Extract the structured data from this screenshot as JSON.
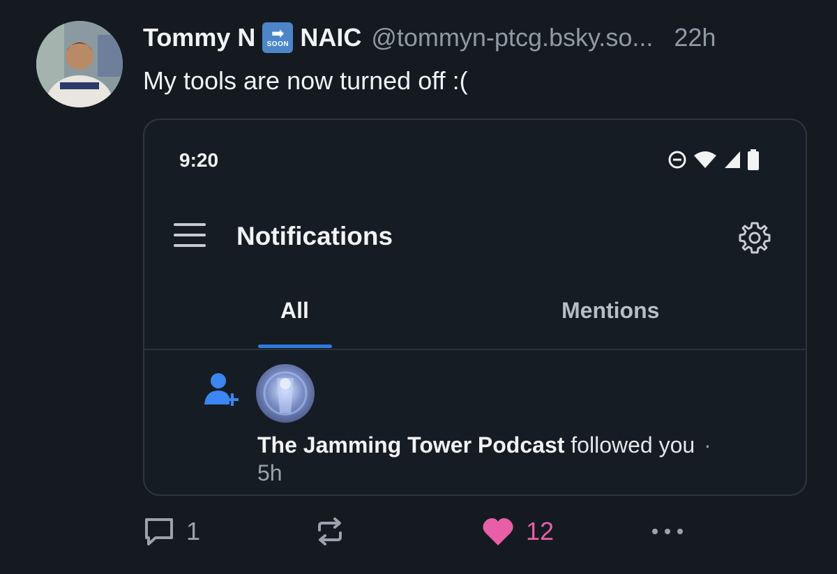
{
  "post": {
    "display_name": "Tommy N",
    "emoji_arrow": "➡",
    "emoji_soon": "SOON",
    "display_name_2": "NAIC",
    "handle": "@tommyn-ptcg.bsky.so...",
    "timestamp": "22h",
    "text": "My tools are now turned off :("
  },
  "embed": {
    "status_time": "9:20",
    "header_title": "Notifications",
    "tabs": [
      {
        "label": "All",
        "active": true
      },
      {
        "label": "Mentions",
        "active": false
      }
    ],
    "notification": {
      "actor": "The Jamming Tower Podcast",
      "action": "followed you",
      "separator": "·",
      "time": "5h"
    }
  },
  "actions": {
    "reply_count": "1",
    "like_count": "12"
  },
  "colors": {
    "background": "#151a21",
    "accent_blue": "#2f7be0",
    "like_pink": "#e85fa7",
    "muted": "#8f9aa6"
  },
  "icons": [
    "avatar",
    "soon-arrow-icon",
    "dnd-icon",
    "wifi-icon",
    "signal-icon",
    "battery-icon",
    "hamburger-menu-icon",
    "gear-icon",
    "follow-user-icon",
    "comment-icon",
    "repost-icon",
    "heart-icon",
    "more-dots-icon"
  ]
}
